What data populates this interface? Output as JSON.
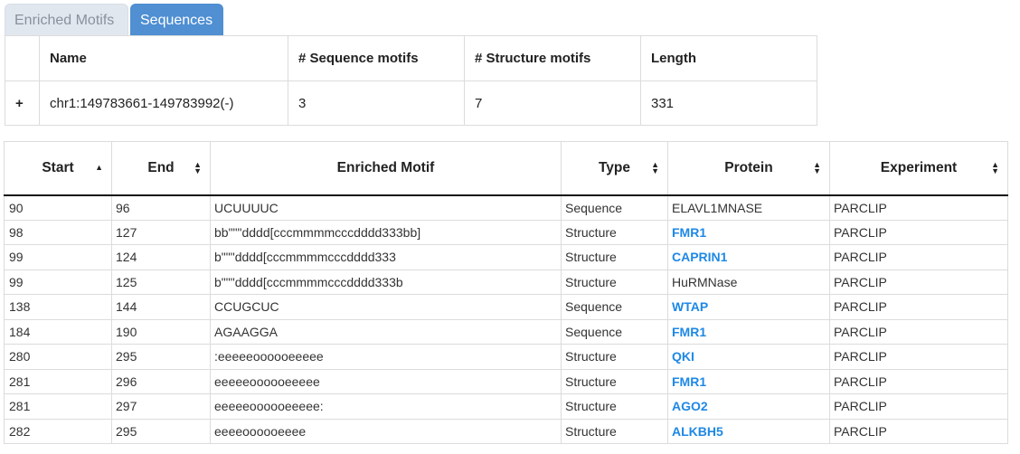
{
  "tabs": [
    {
      "label": "Enriched Motifs",
      "active": false
    },
    {
      "label": "Sequences",
      "active": true
    }
  ],
  "sequences": {
    "expand_icon": "+",
    "headers": [
      "Name",
      "# Sequence motifs",
      "# Structure motifs",
      "Length"
    ],
    "rows": [
      {
        "name": "chr1:149783661-149783992(-)",
        "seq_motifs": "3",
        "struct_motifs": "7",
        "length": "331"
      }
    ]
  },
  "motifs": {
    "headers": [
      "Start",
      "End",
      "Enriched Motif",
      "Type",
      "Protein",
      "Experiment"
    ],
    "rows": [
      {
        "start": "90",
        "end": "96",
        "motif": "UCUUUUC",
        "type": "Sequence",
        "protein": "ELAVL1MNASE",
        "protein_link": false,
        "experiment": "PARCLIP"
      },
      {
        "start": "98",
        "end": "127",
        "motif": "bb\"\"\"dddd[cccmmmmcccdddd333bb]",
        "type": "Structure",
        "protein": "FMR1",
        "protein_link": true,
        "experiment": "PARCLIP"
      },
      {
        "start": "99",
        "end": "124",
        "motif": "b\"\"\"dddd[cccmmmmcccdddd333",
        "type": "Structure",
        "protein": "CAPRIN1",
        "protein_link": true,
        "experiment": "PARCLIP"
      },
      {
        "start": "99",
        "end": "125",
        "motif": "b\"\"\"dddd[cccmmmmcccdddd333b",
        "type": "Structure",
        "protein": "HuRMNase",
        "protein_link": false,
        "experiment": "PARCLIP"
      },
      {
        "start": "138",
        "end": "144",
        "motif": "CCUGCUC",
        "type": "Sequence",
        "protein": "WTAP",
        "protein_link": true,
        "experiment": "PARCLIP"
      },
      {
        "start": "184",
        "end": "190",
        "motif": "AGAAGGA",
        "type": "Sequence",
        "protein": "FMR1",
        "protein_link": true,
        "experiment": "PARCLIP"
      },
      {
        "start": "280",
        "end": "295",
        "motif": ":eeeeeoooooeeeee",
        "type": "Structure",
        "protein": "QKI",
        "protein_link": true,
        "experiment": "PARCLIP"
      },
      {
        "start": "281",
        "end": "296",
        "motif": "eeeeeoooooeeeee",
        "type": "Structure",
        "protein": "FMR1",
        "protein_link": true,
        "experiment": "PARCLIP"
      },
      {
        "start": "281",
        "end": "297",
        "motif": "eeeeeoooooeeeee:",
        "type": "Structure",
        "protein": "AGO2",
        "protein_link": true,
        "experiment": "PARCLIP"
      },
      {
        "start": "282",
        "end": "295",
        "motif": "eeeeoooooeeee",
        "type": "Structure",
        "protein": "ALKBH5",
        "protein_link": true,
        "experiment": "PARCLIP"
      }
    ]
  },
  "colors": {
    "tab_active": "#4f8fd2",
    "tab_inactive": "#e1e7ef",
    "link": "#1e88e5"
  }
}
